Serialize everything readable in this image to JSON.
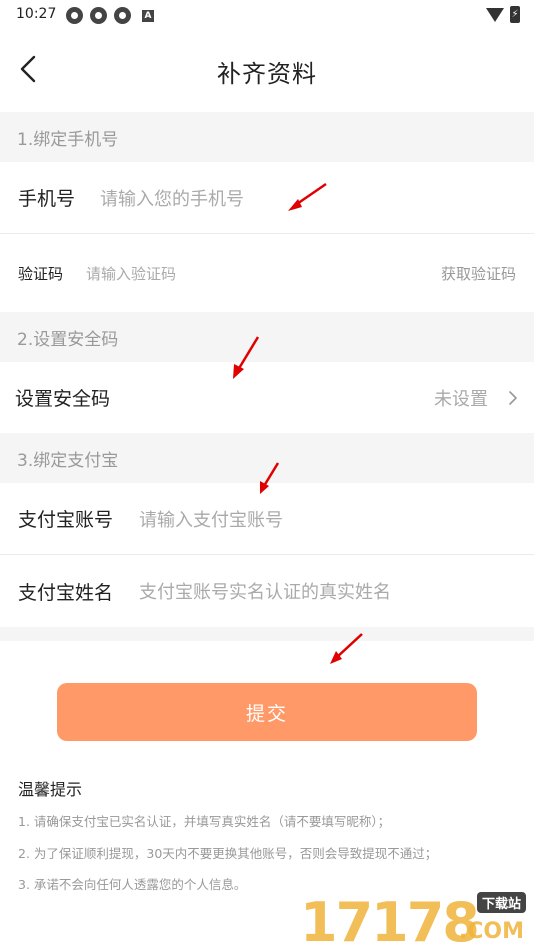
{
  "status_bar": {
    "time": "10:27",
    "notification_badge": "A"
  },
  "header": {
    "title": "补齐资料"
  },
  "sections": {
    "phone": {
      "header": "1.绑定手机号"
    },
    "security": {
      "header": "2.设置安全码"
    },
    "alipay": {
      "header": "3.绑定支付宝"
    }
  },
  "phone_row": {
    "label": "手机号",
    "placeholder": "请输入您的手机号"
  },
  "code_row": {
    "label": "验证码",
    "placeholder": "请输入验证码",
    "action": "获取验证码"
  },
  "security_row": {
    "label": "设置安全码",
    "value": "未设置"
  },
  "alipay_account_row": {
    "label": "支付宝账号",
    "placeholder": "请输入支付宝账号"
  },
  "alipay_name_row": {
    "label": "支付宝姓名",
    "placeholder": "支付宝账号实名认证的真实姓名"
  },
  "submit": {
    "label": "提交"
  },
  "tips": {
    "title": "温馨提示",
    "items": [
      "1. 请确保支付宝已实名认证，并填写真实姓名（请不要填写昵称）；",
      "2. 为了保证顺利提现，30天内不要更换其他账号，否则会导致提现不通过；",
      "3.  承诺不会向任何人透露您的个人信息。"
    ]
  },
  "watermark": {
    "digits": "17178",
    "badge": "下载站",
    "suffix": ".COM"
  },
  "colors": {
    "accent": "#ff9a68",
    "section_bg": "#f5f5f5",
    "placeholder": "#aaaaaa",
    "arrow": "#e00000"
  }
}
